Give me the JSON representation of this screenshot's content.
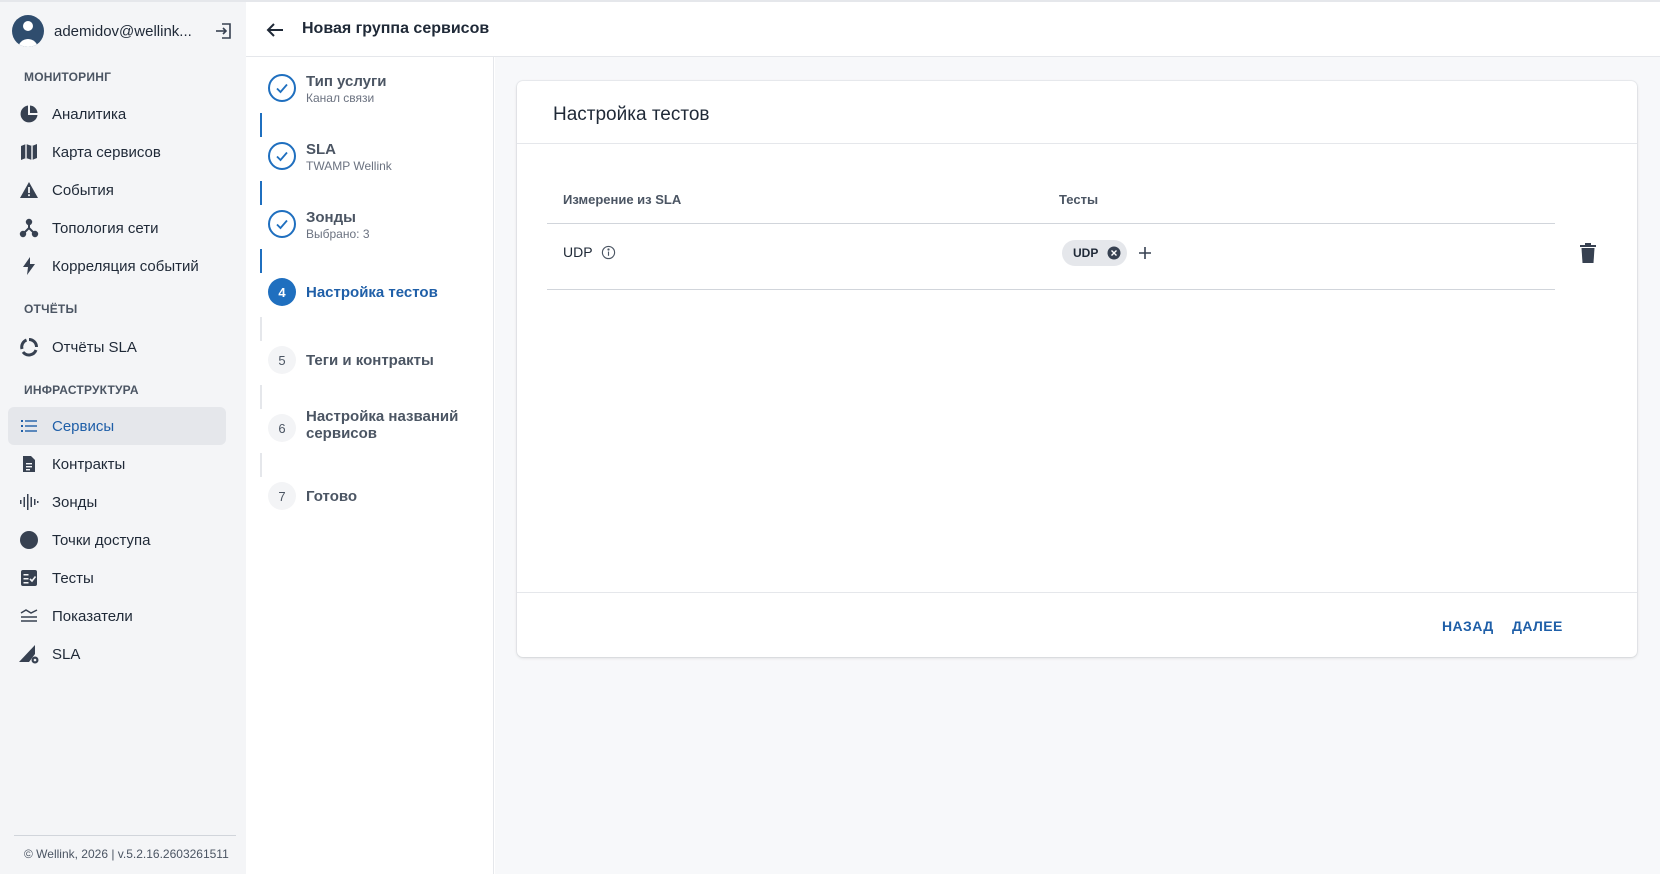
{
  "user": {
    "name": "ademidov@wellink..."
  },
  "sidebar": {
    "sections": [
      {
        "title": "МОНИТОРИНГ"
      },
      {
        "title": "ОТЧЁТЫ"
      },
      {
        "title": "ИНФРАСТРУКТУРА"
      }
    ],
    "items": [
      {
        "label": "Аналитика",
        "icon": "pie-chart-icon"
      },
      {
        "label": "Карта сервисов",
        "icon": "map-icon"
      },
      {
        "label": "События",
        "icon": "warning-icon"
      },
      {
        "label": "Топология сети",
        "icon": "topology-icon"
      },
      {
        "label": "Корреляция событий",
        "icon": "lightning-icon"
      },
      {
        "label": "Отчёты SLA",
        "icon": "donut-icon"
      },
      {
        "label": "Сервисы",
        "icon": "list-icon",
        "active": true
      },
      {
        "label": "Контракты",
        "icon": "document-icon"
      },
      {
        "label": "Зонды",
        "icon": "waveform-icon"
      },
      {
        "label": "Точки доступа",
        "icon": "circle-icon"
      },
      {
        "label": "Тесты",
        "icon": "checklist-icon"
      },
      {
        "label": "Показатели",
        "icon": "metrics-icon"
      },
      {
        "label": "SLA",
        "icon": "sla-gear-icon"
      }
    ],
    "footer": "© Wellink, 2026 | v.5.2.16.2603261511"
  },
  "header": {
    "title": "Новая группа сервисов"
  },
  "stepper": {
    "steps": [
      {
        "title": "Тип услуги",
        "subtitle": "Канал связи",
        "status": "done"
      },
      {
        "title": "SLA",
        "subtitle": "TWAMP Wellink",
        "status": "done"
      },
      {
        "title": "Зонды",
        "subtitle": "Выбрано: 3",
        "status": "done"
      },
      {
        "number": "4",
        "title": "Настройка тестов",
        "status": "current"
      },
      {
        "number": "5",
        "title": "Теги и контракты",
        "status": "pending"
      },
      {
        "number": "6",
        "title": "Настройка названий сервисов",
        "status": "pending"
      },
      {
        "number": "7",
        "title": "Готово",
        "status": "pending"
      }
    ]
  },
  "card": {
    "title": "Настройка тестов",
    "columns": {
      "measurement": "Измерение из SLA",
      "tests": "Тесты"
    },
    "rows": [
      {
        "measurement": "UDP",
        "tests": [
          "UDP"
        ]
      }
    ],
    "buttons": {
      "back": "НАЗАД",
      "next": "ДАЛЕЕ"
    }
  },
  "colors": {
    "accent": "#1f6fbf",
    "active_text": "#1f5fa8",
    "sidebar_bg": "#f4f5f7"
  }
}
